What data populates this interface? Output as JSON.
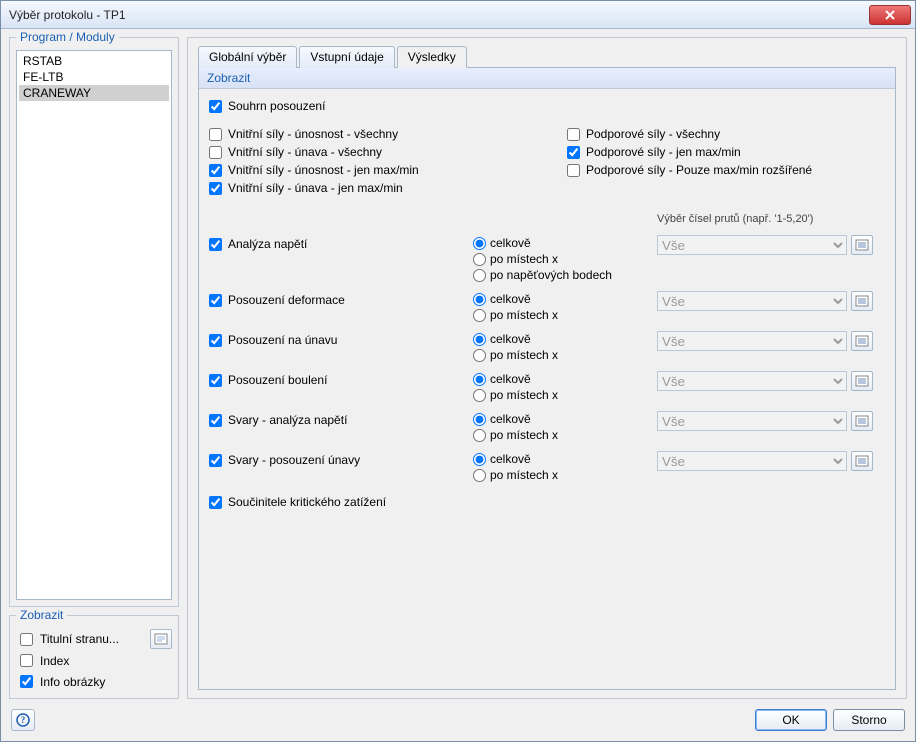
{
  "window": {
    "title": "Výběr protokolu - TP1"
  },
  "left": {
    "program_legend": "Program / Moduly",
    "modules": [
      "RSTAB",
      "FE-LTB",
      "CRANEWAY"
    ],
    "selected_module_index": 2,
    "zobrazit_legend": "Zobrazit",
    "show_titlepage": {
      "label": "Titulní stranu...",
      "checked": false
    },
    "show_index": {
      "label": "Index",
      "checked": false
    },
    "show_info": {
      "label": "Info obrázky",
      "checked": true
    }
  },
  "tabs": {
    "global": "Globální výběr",
    "input": "Vstupní údaje",
    "results": "Výsledky",
    "active_index": 2
  },
  "section": {
    "header": "Zobrazit"
  },
  "cb": {
    "summary": {
      "label": "Souhrn posouzení",
      "checked": true
    },
    "int_unos_all": {
      "label": "Vnitřní síly - únosnost - všechny",
      "checked": false
    },
    "int_unav_all": {
      "label": "Vnitřní síly - únava - všechny",
      "checked": false
    },
    "int_unos_max": {
      "label": "Vnitřní síly - únosnost - jen max/min",
      "checked": true
    },
    "int_unav_max": {
      "label": "Vnitřní síly - únava - jen max/min",
      "checked": true
    },
    "sup_all": {
      "label": "Podporové síly - všechny",
      "checked": false
    },
    "sup_max": {
      "label": "Podporové síly - jen max/min",
      "checked": true
    },
    "sup_max_ext": {
      "label": "Podporové síly - Pouze max/min rozšířené",
      "checked": false
    },
    "coef": {
      "label": "Součinitele kritického zatížení",
      "checked": true
    }
  },
  "radio_labels": {
    "celkove": "celkově",
    "po_mistech": "po místech x",
    "po_napetovych": "po napěťových bodech"
  },
  "select_header": "Výběr čísel prutů (např. '1-5,20')",
  "rows": {
    "stress": {
      "label": "Analýza napětí",
      "checked": true,
      "combo": "Vše",
      "opts": [
        "celkove",
        "po_mistech",
        "po_napetovych"
      ],
      "sel": 0
    },
    "deform": {
      "label": "Posouzení deformace",
      "checked": true,
      "combo": "Vše",
      "opts": [
        "celkove",
        "po_mistech"
      ],
      "sel": 0
    },
    "fatigue": {
      "label": "Posouzení na únavu",
      "checked": true,
      "combo": "Vše",
      "opts": [
        "celkove",
        "po_mistech"
      ],
      "sel": 0
    },
    "buckling": {
      "label": "Posouzení boulení",
      "checked": true,
      "combo": "Vše",
      "opts": [
        "celkove",
        "po_mistech"
      ],
      "sel": 0
    },
    "weld_stress": {
      "label": "Svary - analýza napětí",
      "checked": true,
      "combo": "Vše",
      "opts": [
        "celkove",
        "po_mistech"
      ],
      "sel": 0
    },
    "weld_fat": {
      "label": "Svary - posouzení únavy",
      "checked": true,
      "combo": "Vše",
      "opts": [
        "celkove",
        "po_mistech"
      ],
      "sel": 0
    }
  },
  "buttons": {
    "ok": "OK",
    "cancel": "Storno"
  }
}
